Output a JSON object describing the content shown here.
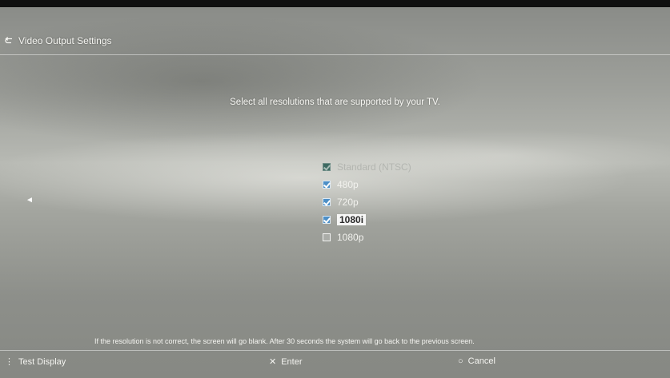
{
  "header": {
    "title": "Video Output Settings",
    "icon": "back-arrow-icon"
  },
  "prompt": "Select all resolutions that are supported by your TV.",
  "options": [
    {
      "label": "Standard (NTSC)",
      "checked": true,
      "disabled": true
    },
    {
      "label": "480p",
      "checked": true
    },
    {
      "label": "720p",
      "checked": true
    },
    {
      "label": "1080i",
      "checked": true,
      "selected": true
    },
    {
      "label": "1080p",
      "checked": false
    }
  ],
  "left_indicator": "◄",
  "footer": {
    "note": "If the resolution is not correct, the screen will go blank. After 30 seconds the system will go back to the previous screen.",
    "buttons": [
      {
        "glyph": "⋮",
        "label": "Test Display"
      },
      {
        "glyph": "✕",
        "label": "Enter"
      },
      {
        "glyph": "○",
        "label": "Cancel"
      }
    ]
  }
}
